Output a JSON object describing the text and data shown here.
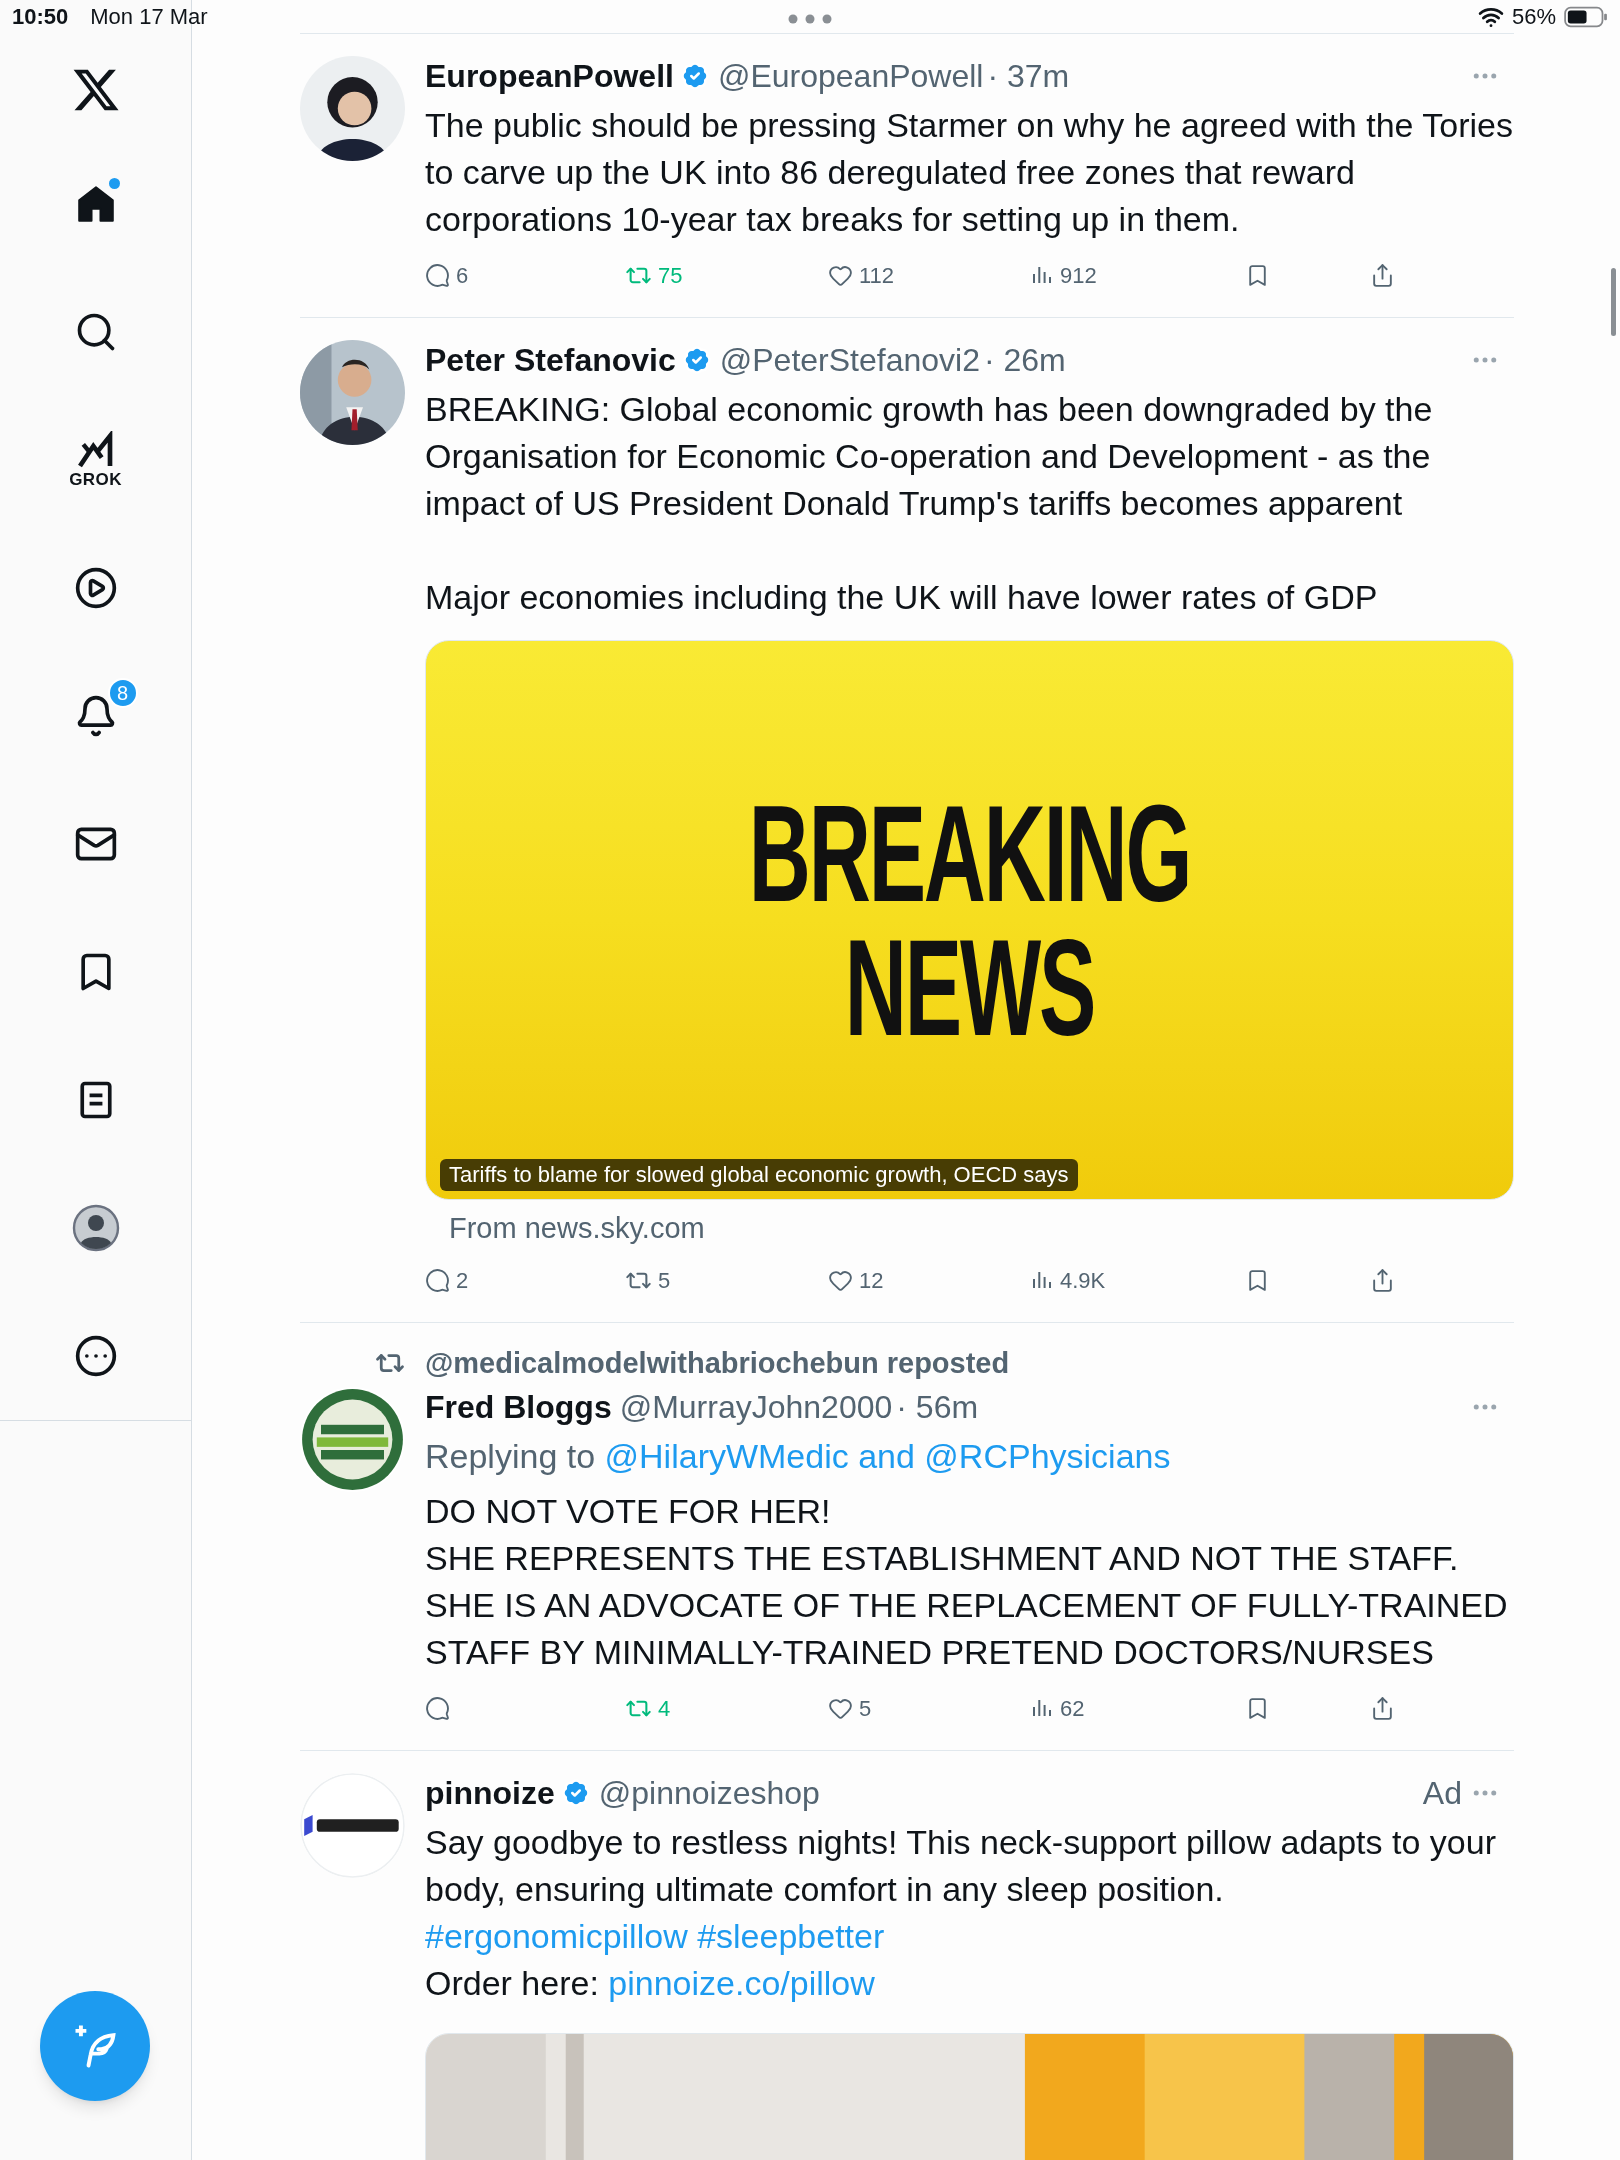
{
  "status_bar": {
    "time": "10:50",
    "date": "Mon 17 Mar",
    "battery": "56%"
  },
  "sidebar": {
    "items": [
      {
        "kind": "logo"
      },
      {
        "kind": "home",
        "selected": true,
        "dot": true
      },
      {
        "kind": "search",
        "selected": false
      },
      {
        "kind": "grok",
        "label": "GROK",
        "selected": false
      },
      {
        "kind": "video",
        "selected": false
      },
      {
        "kind": "notifications",
        "selected": false,
        "badge": "8"
      },
      {
        "kind": "messages",
        "selected": false
      },
      {
        "kind": "bookmarks",
        "selected": false
      },
      {
        "kind": "lists",
        "selected": false
      },
      {
        "kind": "profile",
        "selected": false
      },
      {
        "kind": "more",
        "selected": false
      }
    ]
  },
  "tweets": [
    {
      "name": "EuropeanPowell",
      "verified": true,
      "handle": "@EuropeanPowell",
      "time": "· 37m",
      "body": [
        {
          "segments": [
            {
              "text": "The public should be pressing Starmer on why he agreed with the Tories to carve up the UK into 86 deregulated free zones that reward corporations 10-year tax breaks for setting up in them."
            }
          ]
        }
      ],
      "actions": {
        "replies": "6",
        "reposts": "75",
        "reposted": true,
        "likes": "112",
        "views": "912"
      }
    },
    {
      "name": "Peter Stefanovic",
      "verified": true,
      "handle": "@PeterStefanovi2",
      "time": "· 26m",
      "body": [
        {
          "segments": [
            {
              "text": "BREAKING: Global economic growth has been downgraded by the Organisation for Economic Co-operation and Development - as the impact of US President Donald Trump's tariffs becomes apparent"
            }
          ]
        },
        {
          "spaced": true,
          "segments": [
            {
              "text": "Major economies including the UK will have lower rates of GDP"
            }
          ]
        }
      ],
      "media": {
        "kind": "card",
        "headline": [
          "BREAKING",
          "NEWS"
        ],
        "caption": "Tariffs to blame for slowed global economic growth, OECD says",
        "source": "From news.sky.com"
      },
      "actions": {
        "replies": "2",
        "reposts": "5",
        "reposted": false,
        "likes": "12",
        "views": "4.9K"
      }
    },
    {
      "repost_by": "@medicalmodelwithabriochebun reposted",
      "name": "Fred Bloggs",
      "verified": false,
      "handle": "@MurrayJohn2000",
      "time": "· 56m",
      "replying_to": [
        {
          "text": "Replying to "
        },
        {
          "text": "@HilaryWMedic and @RCPhysicians",
          "link": true
        }
      ],
      "body": [
        {
          "segments": [
            {
              "text": "DO NOT VOTE FOR HER!"
            }
          ]
        },
        {
          "segments": [
            {
              "text": "SHE REPRESENTS THE ESTABLISHMENT AND NOT THE STAFF."
            }
          ]
        },
        {
          "segments": [
            {
              "text": "SHE IS AN ADVOCATE OF THE REPLACEMENT OF FULLY-TRAINED STAFF BY MINIMALLY-TRAINED PRETEND DOCTORS/NURSES"
            }
          ]
        }
      ],
      "actions": {
        "reposts": "4",
        "reposted": true,
        "likes": "5",
        "views": "62"
      }
    },
    {
      "name": "pinnoize",
      "verified": true,
      "handle": "@pinnoizeshop",
      "ad_label": "Ad",
      "body": [
        {
          "segments": [
            {
              "text": "Say goodbye to restless nights! This neck-support pillow adapts to your body, ensuring ultimate comfort in any sleep position."
            }
          ]
        },
        {
          "segments": [
            {
              "text": "#ergonomicpillow #sleepbetter",
              "link": true
            }
          ]
        },
        {
          "segments": [
            {
              "text": "Order here: "
            },
            {
              "text": "pinnoize.co/pillow",
              "link": true
            }
          ]
        }
      ],
      "media": {
        "kind": "picture"
      }
    }
  ]
}
